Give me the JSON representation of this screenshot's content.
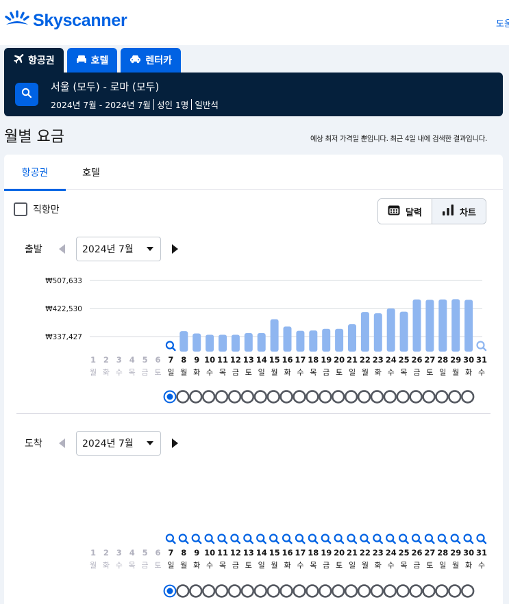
{
  "brand": {
    "name": "Skyscanner"
  },
  "header": {
    "help": "도움말"
  },
  "tabs": [
    {
      "label": "항공권",
      "icon": "airplane-icon",
      "active": true
    },
    {
      "label": "호텔",
      "icon": "bed-icon",
      "active": false
    },
    {
      "label": "렌터카",
      "icon": "car-icon",
      "active": false
    }
  ],
  "search": {
    "route": "서울 (모두) - 로마 (모두)",
    "dates": "2024년 7월 - 2024년 7월",
    "travelers": "성인 1명",
    "cabin": "일반석"
  },
  "page": {
    "title": "월별 요금",
    "disclaimer": "예상 최저 가격일 뿐입니다. 최근 4일 내에 검색한 결과입니다."
  },
  "card_tabs": [
    {
      "label": "항공권",
      "active": true
    },
    {
      "label": "호텔",
      "active": false
    }
  ],
  "filters": {
    "direct_only": "직항만",
    "direct_only_checked": false
  },
  "view_toggle": {
    "calendar": "달력",
    "chart": "차트",
    "selected": "chart"
  },
  "departure": {
    "label": "출발",
    "month": "2024년 7월"
  },
  "arrival": {
    "label": "도착",
    "month": "2024년 7월"
  },
  "colors": {
    "accent": "#0062e3",
    "navy": "#05203c",
    "bar": "#8fb6f0",
    "muted": "#b2b2bf"
  },
  "chart_data": [
    {
      "type": "bar",
      "name": "departure",
      "categories": [
        "1",
        "2",
        "3",
        "4",
        "5",
        "6",
        "7",
        "8",
        "9",
        "10",
        "11",
        "12",
        "13",
        "14",
        "15",
        "16",
        "17",
        "18",
        "19",
        "20",
        "21",
        "22",
        "23",
        "24",
        "25",
        "26",
        "27",
        "28",
        "29",
        "30",
        "31"
      ],
      "weekdays": [
        "월",
        "화",
        "수",
        "목",
        "금",
        "토",
        "일",
        "월",
        "화",
        "수",
        "목",
        "금",
        "토",
        "일",
        "월",
        "화",
        "수",
        "목",
        "금",
        "토",
        "일",
        "월",
        "화",
        "수",
        "목",
        "금",
        "토",
        "일",
        "월",
        "화",
        "수"
      ],
      "values": [
        null,
        null,
        null,
        null,
        null,
        null,
        null,
        354000,
        347000,
        343000,
        343000,
        343000,
        348000,
        348000,
        390000,
        368000,
        355000,
        356000,
        361000,
        361000,
        375000,
        412000,
        408000,
        423000,
        413000,
        450000,
        449000,
        450000,
        451000,
        449000,
        null
      ],
      "yticks": [
        "₩507,633",
        "₩422,530",
        "₩337,427"
      ],
      "ytick_values": [
        507633,
        422530,
        337427
      ],
      "ylim": [
        292000,
        507633
      ],
      "unavailable_past": [
        1,
        2,
        3,
        4,
        5,
        6
      ],
      "search_days": [
        7,
        31
      ],
      "selected_day": 7
    },
    {
      "type": "bar",
      "name": "arrival",
      "categories": [
        "1",
        "2",
        "3",
        "4",
        "5",
        "6",
        "7",
        "8",
        "9",
        "10",
        "11",
        "12",
        "13",
        "14",
        "15",
        "16",
        "17",
        "18",
        "19",
        "20",
        "21",
        "22",
        "23",
        "24",
        "25",
        "26",
        "27",
        "28",
        "29",
        "30",
        "31"
      ],
      "weekdays": [
        "월",
        "화",
        "수",
        "목",
        "금",
        "토",
        "일",
        "월",
        "화",
        "수",
        "목",
        "금",
        "토",
        "일",
        "월",
        "화",
        "수",
        "목",
        "금",
        "토",
        "일",
        "월",
        "화",
        "수",
        "목",
        "금",
        "토",
        "일",
        "월",
        "화",
        "수"
      ],
      "values": [
        null,
        null,
        null,
        null,
        null,
        null,
        null,
        null,
        null,
        null,
        null,
        null,
        null,
        null,
        null,
        null,
        null,
        null,
        null,
        null,
        null,
        null,
        null,
        null,
        null,
        null,
        null,
        null,
        null,
        null,
        null
      ],
      "unavailable_past": [
        1,
        2,
        3,
        4,
        5,
        6
      ],
      "search_days": [
        7,
        8,
        9,
        10,
        11,
        12,
        13,
        14,
        15,
        16,
        17,
        18,
        19,
        20,
        21,
        22,
        23,
        24,
        25,
        26,
        27,
        28,
        29,
        30,
        31
      ],
      "selected_day": 7
    }
  ]
}
